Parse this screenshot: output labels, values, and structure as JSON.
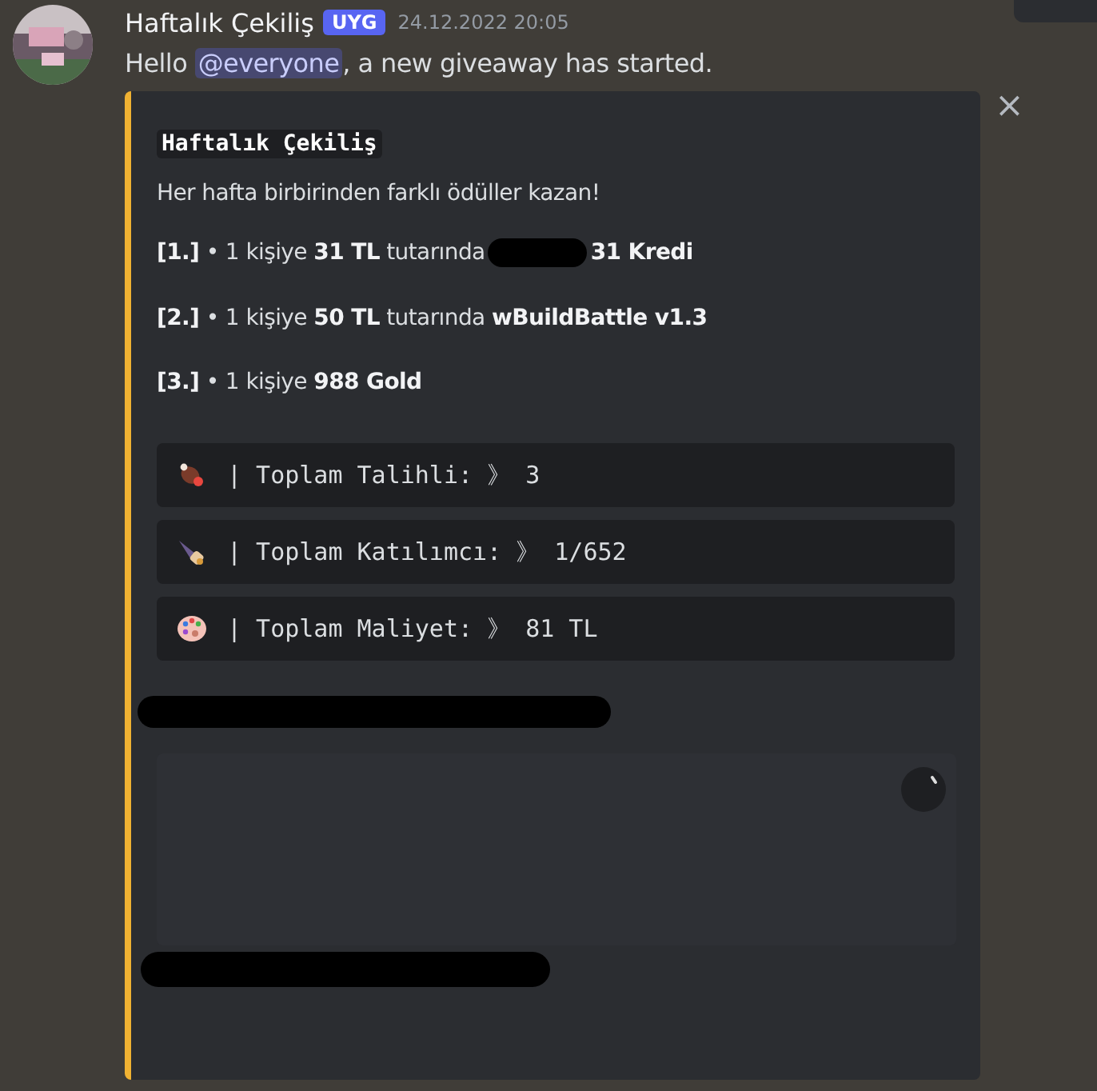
{
  "message": {
    "author": "Haftalık Çekiliş",
    "tag": "UYG",
    "timestamp": "24.12.2022 20:05",
    "text_before": "Hello ",
    "mention": "@everyone",
    "text_after": ", a new giveaway has started."
  },
  "embed": {
    "title": "Haftalık Çekiliş",
    "description": "Her hafta birbirinden farklı ödüller kazan!",
    "prizes": [
      {
        "text": "**[1.]** • 1 kişiye **31 TL** tutarında",
        "redacted": true,
        "rest": "**31 Kredi**"
      },
      {
        "text": "**[2.]** • 1 kişiye **50 TL** tutarında **wBuildBattle v1.3**",
        "redacted": false
      },
      {
        "text": "**[3.]** • 1 kişiye **988 Gold**",
        "redacted": false
      }
    ],
    "stats": [
      {
        "kind": "meat",
        "text": "| Toplam Talihli: 》 3"
      },
      {
        "kind": "cone",
        "text": "| Toplam Katılımcı: 》 1/652"
      },
      {
        "kind": "palette",
        "text": "| Toplam Maliyet: 》 81 TL"
      }
    ],
    "close": "×"
  }
}
